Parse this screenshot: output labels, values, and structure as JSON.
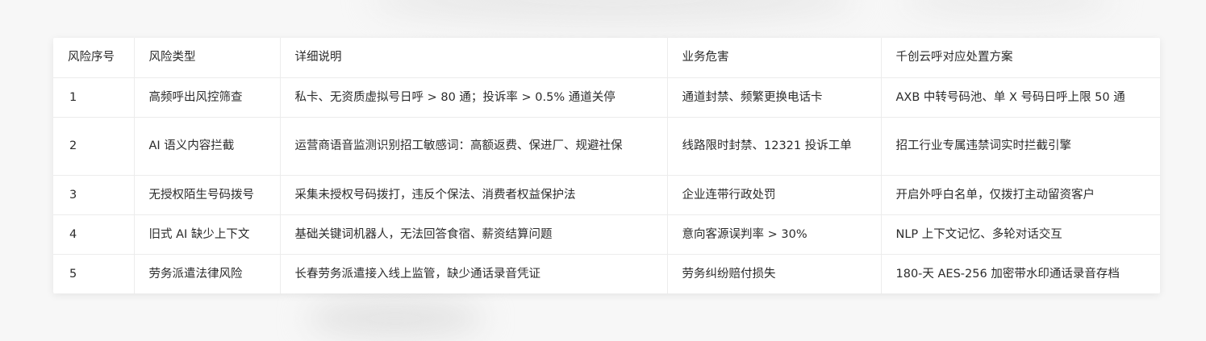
{
  "table": {
    "headers": [
      "风险序号",
      "风险类型",
      "详细说明",
      "业务危害",
      "千创云呼对应处置方案"
    ],
    "rows": [
      {
        "index": "1",
        "type": "高频呼出风控筛查",
        "detail": "私卡、无资质虚拟号日呼 > 80 通；投诉率 > 0.5% 通道关停",
        "harm": "通道封禁、频繁更换电话卡",
        "solution": "AXB 中转号码池、单 X 号码日呼上限 50 通"
      },
      {
        "index": "2",
        "type": "AI 语义内容拦截",
        "detail": "运营商语音监测识别招工敏感词：高额返费、保进厂、规避社保",
        "harm": "线路限时封禁、12321 投诉工单",
        "solution": "招工行业专属违禁词实时拦截引擎"
      },
      {
        "index": "3",
        "type": "无授权陌生号码拨号",
        "detail": "采集未授权号码拨打，违反个保法、消费者权益保护法",
        "harm": "企业连带行政处罚",
        "solution": "开启外呼白名单，仅拨打主动留资客户"
      },
      {
        "index": "4",
        "type": "旧式 AI 缺少上下文",
        "detail": "基础关键词机器人，无法回答食宿、薪资结算问题",
        "harm": "意向客源误判率 > 30%",
        "solution": "NLP 上下文记忆、多轮对话交互"
      },
      {
        "index": "5",
        "type": "劳务派遣法律风险",
        "detail": "长春劳务派遣接入线上监管，缺少通话录音凭证",
        "harm": "劳务纠纷赔付损失",
        "solution": "180-天 AES-256 加密带水印通话录音存档"
      }
    ]
  }
}
